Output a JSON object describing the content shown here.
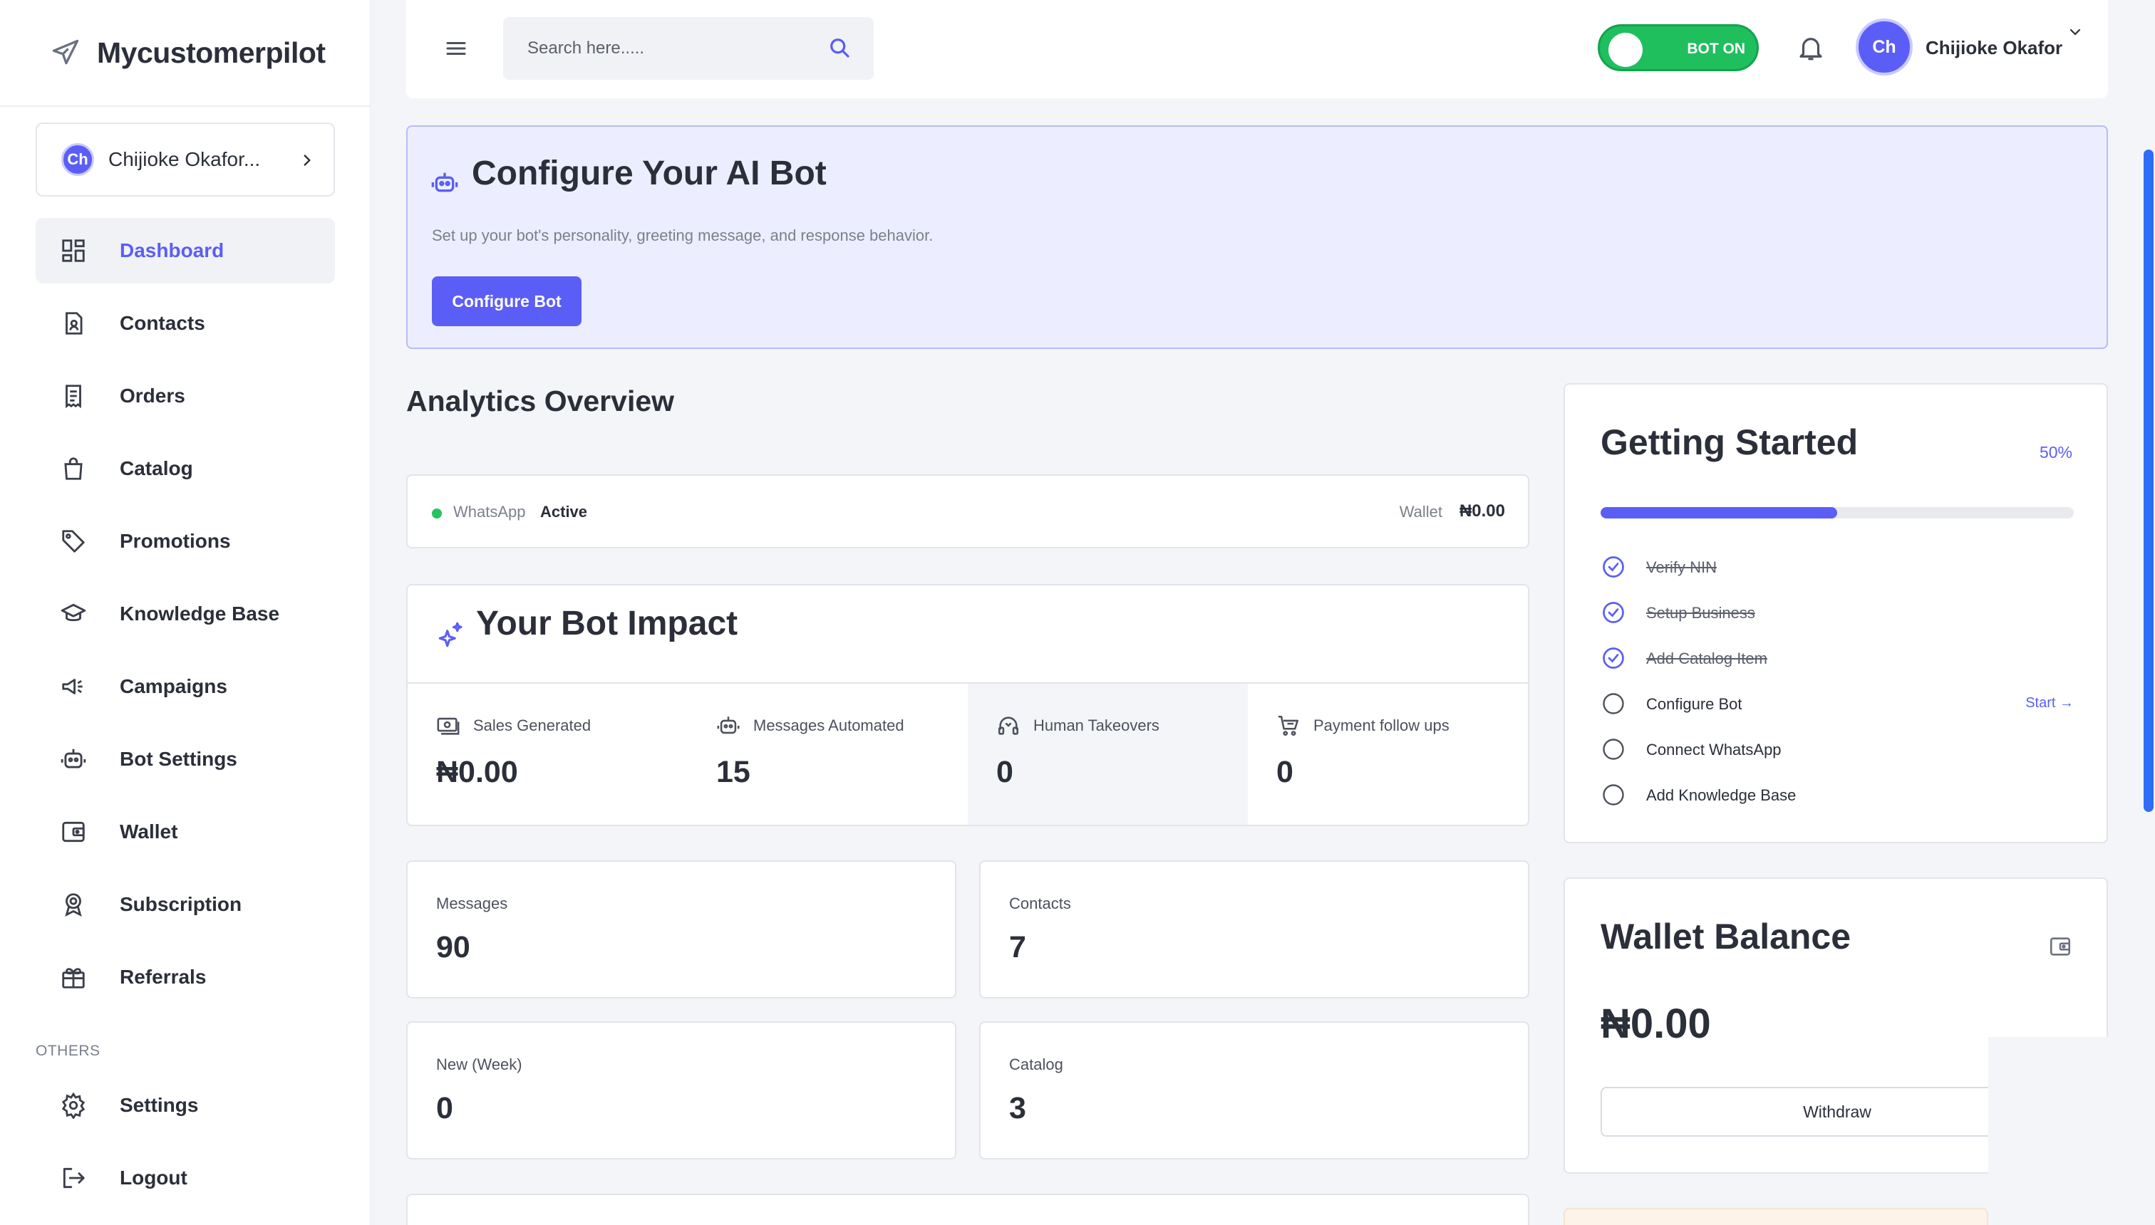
{
  "brand": {
    "name": "Mycustomerpilot",
    "icon": "paper-plane-icon"
  },
  "account": {
    "initials": "Ch",
    "name": "Chijioke Okafor..."
  },
  "sidebar": {
    "items": [
      {
        "label": "Dashboard",
        "icon": "dashboard-grid-icon",
        "active": true
      },
      {
        "label": "Contacts",
        "icon": "contact-book-icon"
      },
      {
        "label": "Orders",
        "icon": "receipt-icon"
      },
      {
        "label": "Catalog",
        "icon": "shopping-bag-icon"
      },
      {
        "label": "Promotions",
        "icon": "tag-icon"
      },
      {
        "label": "Knowledge Base",
        "icon": "graduation-cap-icon"
      },
      {
        "label": "Campaigns",
        "icon": "megaphone-icon"
      },
      {
        "label": "Bot Settings",
        "icon": "robot-icon"
      },
      {
        "label": "Wallet",
        "icon": "wallet-icon"
      },
      {
        "label": "Subscription",
        "icon": "award-badge-icon"
      },
      {
        "label": "Referrals",
        "icon": "gift-icon"
      }
    ],
    "others_label": "OTHERS",
    "others": [
      {
        "label": "Settings",
        "icon": "gear-icon"
      },
      {
        "label": "Logout",
        "icon": "logout-icon"
      }
    ]
  },
  "topbar": {
    "search_placeholder": "Search here.....",
    "bot_toggle_label": "BOT ON",
    "bot_on": true,
    "user_initials": "Ch",
    "user_name": "Chijioke Okafor"
  },
  "banner": {
    "title": "Configure Your AI Bot",
    "description": "Set up your bot's personality, greeting message, and response behavior.",
    "button": "Configure Bot"
  },
  "analytics": {
    "title": "Analytics Overview",
    "status": {
      "channel_label": "WhatsApp",
      "channel_status": "Active",
      "wallet_label": "Wallet",
      "wallet_value": "₦0.00"
    },
    "impact": {
      "title": "Your Bot Impact",
      "metrics": [
        {
          "label": "Sales Generated",
          "value": "₦0.00",
          "icon": "cash-icon"
        },
        {
          "label": "Messages Automated",
          "value": "15",
          "icon": "robot-icon"
        },
        {
          "label": "Human Takeovers",
          "value": "0",
          "icon": "headset-icon"
        },
        {
          "label": "Payment follow ups",
          "value": "0",
          "icon": "cart-icon"
        }
      ]
    },
    "stats": [
      {
        "label": "Messages",
        "value": "90"
      },
      {
        "label": "Contacts",
        "value": "7"
      },
      {
        "label": "New (Week)",
        "value": "0"
      },
      {
        "label": "Catalog",
        "value": "3"
      }
    ]
  },
  "getting_started": {
    "title": "Getting Started",
    "percent_label": "50%",
    "progress": 0.5,
    "tasks": [
      {
        "label": "Verify NIN",
        "done": true
      },
      {
        "label": "Setup Business",
        "done": true
      },
      {
        "label": "Add Catalog Item",
        "done": true
      },
      {
        "label": "Configure Bot",
        "done": false,
        "action": "Start →"
      },
      {
        "label": "Connect WhatsApp",
        "done": false
      },
      {
        "label": "Add Knowledge Base",
        "done": false
      }
    ]
  },
  "wallet_balance": {
    "title": "Wallet Balance",
    "value": "₦0.00",
    "button": "Withdraw"
  },
  "colors": {
    "accent": "#5b5ef6",
    "toggle_on": "#1fbf5e",
    "banner_bg": "#eceeff",
    "status_dot": "#22c55e"
  }
}
